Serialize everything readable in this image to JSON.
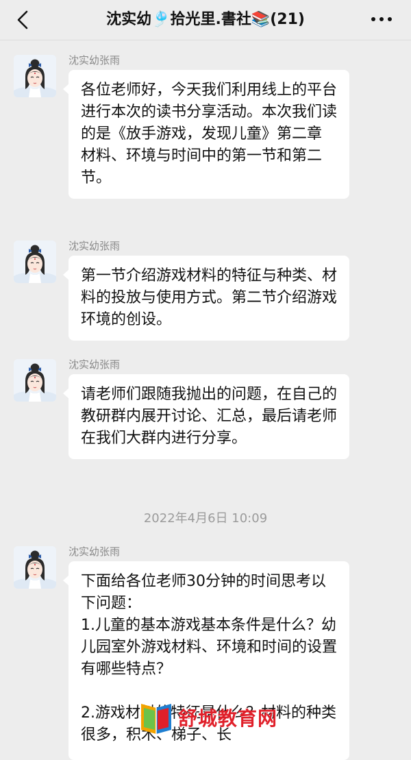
{
  "header": {
    "title": "沈实幼🎐拾光里.書社📚(21)",
    "back_icon": "chevron-left-icon",
    "more_icon": "more-dots-icon"
  },
  "messages": [
    {
      "sender": "沈实幼张雨",
      "text": "各位老师好，今天我们利用线上的平台进行本次的读书分享活动。本次我们读的是《放手游戏，发现儿童》第二章　材料、环境与时间中的第一节和第二节。"
    },
    {
      "sender": "沈实幼张雨",
      "text": "第一节介绍游戏材料的特征与种类、材料的投放与使用方式。第二节介绍游戏环境的创设。"
    },
    {
      "sender": "沈实幼张雨",
      "text": "请老师们跟随我抛出的问题，在自己的教研群内展开讨论、汇总，最后请老师在我们大群内进行分享。"
    },
    {
      "sender": "沈实幼张雨",
      "text": "下面给各位老师30分钟的时间思考以下问题：\n1.儿童的基本游戏基本条件是什么？幼儿园室外游戏材料、环境和时间的设置有哪些特点？\n\n2.游戏材料的特征是什么？材料的种类很多，积木、梯子、长"
    }
  ],
  "timestamp": "2022年4月6日 10:09",
  "watermark": {
    "text": "舒城教育网",
    "icon": "book-logo-icon"
  },
  "colors": {
    "background": "#ededed",
    "bubble": "#ffffff",
    "meta_text": "#8a8a8a",
    "watermark": "#e0202a"
  }
}
